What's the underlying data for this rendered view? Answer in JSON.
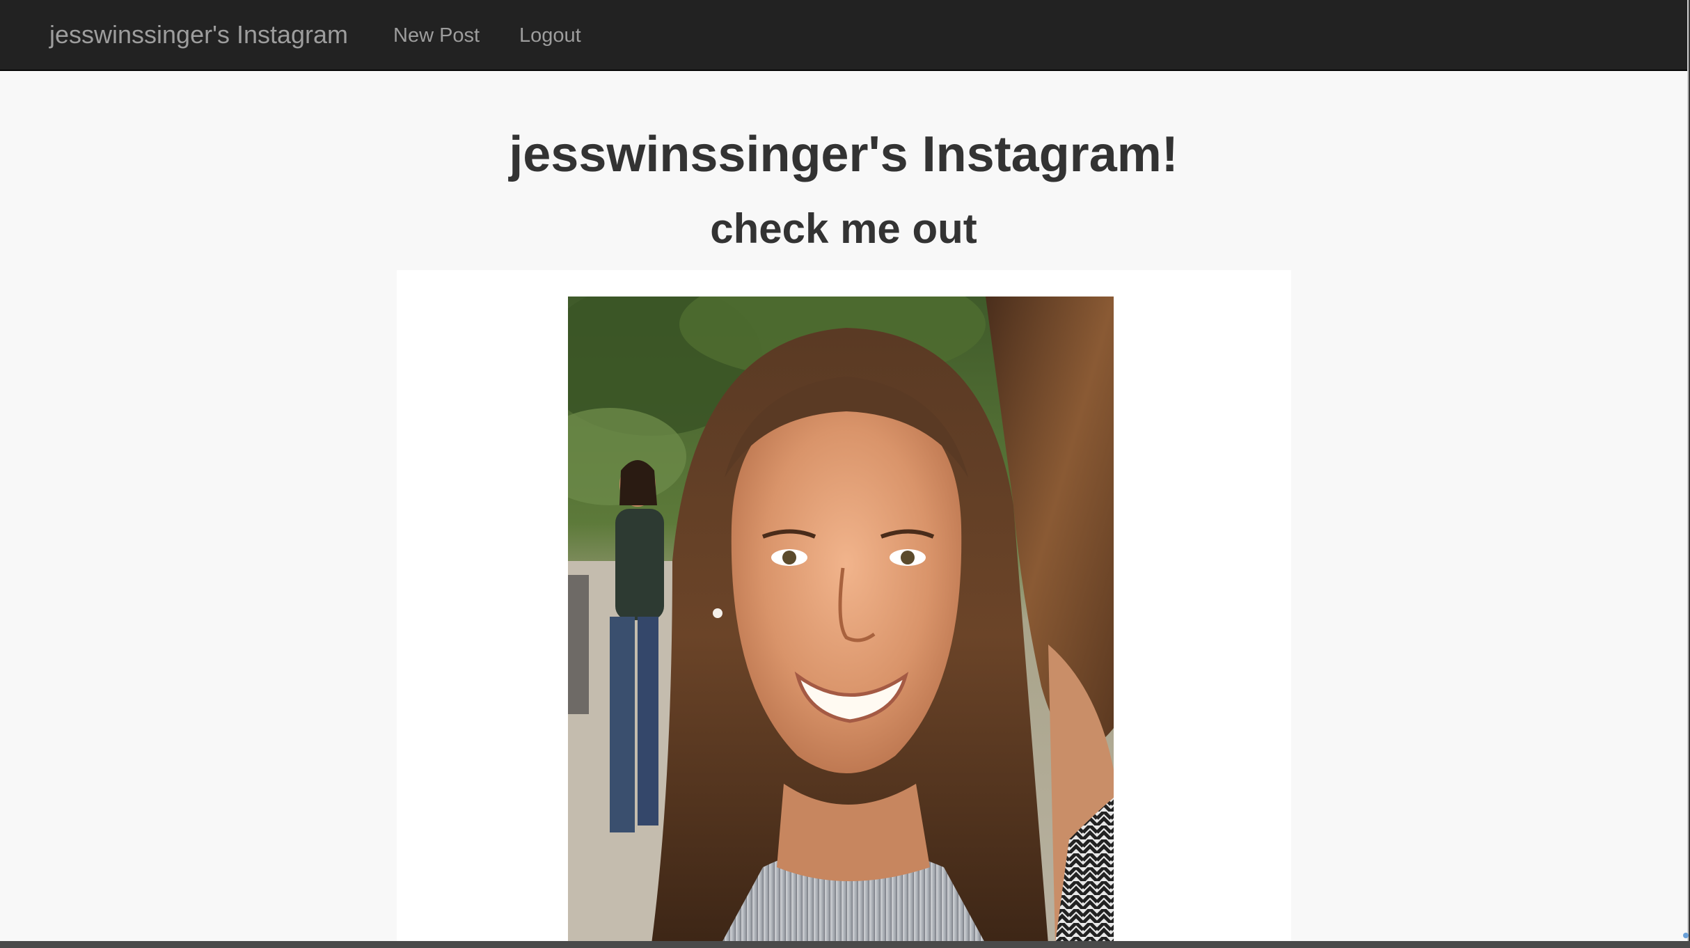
{
  "navbar": {
    "brand": "jesswinssinger's Instagram",
    "links": [
      {
        "label": "New Post"
      },
      {
        "label": "Logout"
      }
    ]
  },
  "main": {
    "title": "jesswinssinger's Instagram!",
    "post": {
      "caption": "check me out",
      "image_alt": "smiling woman with long brown hair outdoors"
    }
  },
  "colors": {
    "navbar_bg": "#222222",
    "nav_text": "#9d9d9d",
    "page_bg": "#f8f8f8",
    "card_bg": "#ffffff",
    "heading_text": "#333333"
  }
}
